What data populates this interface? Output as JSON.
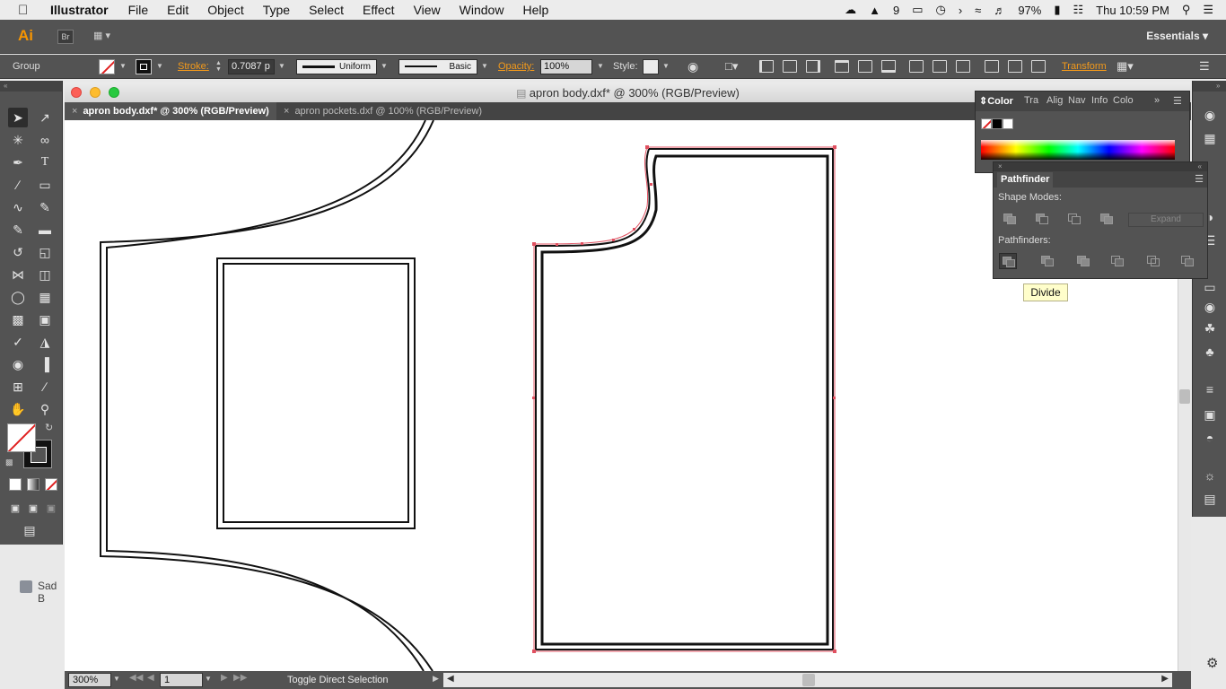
{
  "menubar": {
    "apple_icon": "apple-icon",
    "app_name": "Illustrator",
    "menus": [
      "File",
      "Edit",
      "Object",
      "Type",
      "Select",
      "Effect",
      "View",
      "Window",
      "Help"
    ],
    "status": {
      "adobe_count": "9",
      "battery": "97%",
      "clock": "Thu 10:59 PM"
    }
  },
  "appbar": {
    "logo": "Ai",
    "bridge": "Br",
    "workspace": "Essentials"
  },
  "control": {
    "selection_type": "Group",
    "stroke_label": "Stroke:",
    "stroke_weight": "0.7087 p",
    "stroke_profile": "Uniform",
    "brush": "Basic",
    "opacity_label": "Opacity:",
    "opacity_value": "100%",
    "style_label": "Style:",
    "transform_label": "Transform"
  },
  "document": {
    "window_title": "apron body.dxf* @ 300% (RGB/Preview)",
    "tabs": [
      {
        "label": "apron body.dxf* @ 300% (RGB/Preview)",
        "active": true
      },
      {
        "label": "apron pockets.dxf @ 100% (RGB/Preview)",
        "active": false
      }
    ],
    "zoom": "300%",
    "artboard": "1",
    "status": "Toggle Direct Selection"
  },
  "color_panel": {
    "tabs": [
      "Color",
      "Tra",
      "Alig",
      "Nav",
      "Info",
      "Colo"
    ]
  },
  "pathfinder": {
    "title": "Pathfinder",
    "shape_modes_label": "Shape Modes:",
    "pathfinders_label": "Pathfinders:",
    "expand_label": "Expand",
    "tooltip": "Divide"
  },
  "desktop": {
    "item_label": "Sad B"
  },
  "colors": {
    "chrome": "#535353",
    "accent_orange": "#f49a1a",
    "selection_red": "#e05060"
  }
}
